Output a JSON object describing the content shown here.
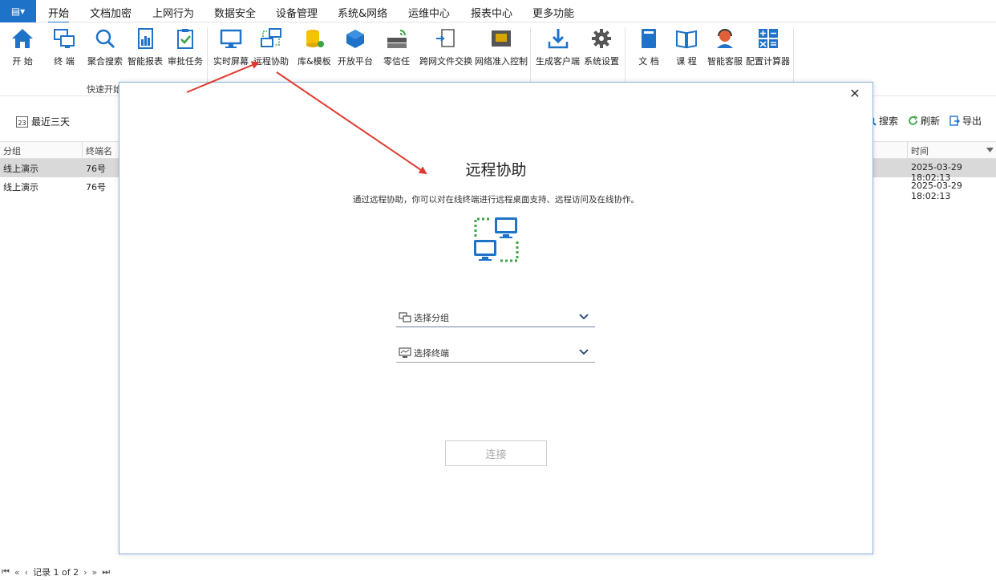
{
  "app_button": "▤▾",
  "menu": [
    "开始",
    "文档加密",
    "上网行为",
    "数据安全",
    "设备管理",
    "系统&网络",
    "运维中心",
    "报表中心",
    "更多功能"
  ],
  "ribbon": {
    "group_label": "快速开始",
    "items": [
      {
        "label": "开 始",
        "icon": "home-icon"
      },
      {
        "label": "终 端",
        "icon": "terminals-icon"
      },
      {
        "label": "聚合搜索",
        "icon": "search-icon"
      },
      {
        "label": "智能报表",
        "icon": "report-icon"
      },
      {
        "label": "审批任务",
        "icon": "approval-icon"
      },
      {
        "label": "实时屏幕",
        "icon": "monitor-icon"
      },
      {
        "label": "远程协助",
        "icon": "remote-icon"
      },
      {
        "label": "库&模板",
        "icon": "database-icon"
      },
      {
        "label": "开放平台",
        "icon": "cube-icon"
      },
      {
        "label": "零信任",
        "icon": "zero-trust-icon"
      },
      {
        "label": "跨网文件交换",
        "icon": "file-exchange-icon"
      },
      {
        "label": "网络准入控制",
        "icon": "access-control-icon"
      },
      {
        "label": "生成客户端",
        "icon": "download-icon"
      },
      {
        "label": "系统设置",
        "icon": "gear-icon"
      },
      {
        "label": "文 档",
        "icon": "book-icon"
      },
      {
        "label": "课 程",
        "icon": "course-icon"
      },
      {
        "label": "智能客服",
        "icon": "support-icon"
      },
      {
        "label": "配置计算器",
        "icon": "calculator-icon"
      }
    ]
  },
  "toolbar": {
    "date_filter": "最近三天",
    "calendar_day": "23",
    "search": "搜索",
    "refresh": "刷新",
    "export": "导出"
  },
  "table": {
    "columns": [
      "分组",
      "终端名",
      "时间"
    ],
    "rows": [
      {
        "group": "线上演示",
        "terminal": "76号",
        "time": "2025-03-29 18:02:13"
      },
      {
        "group": "线上演示",
        "terminal": "76号",
        "time": "2025-03-29 18:02:13"
      }
    ]
  },
  "pager": {
    "text": "记录 1 of 2"
  },
  "dialog": {
    "title": "远程协助",
    "description": "通过远程协助，你可以对在线终端进行远程桌面支持、远程访问及在线协作。",
    "select_group": "选择分组",
    "select_terminal": "选择终端",
    "connect": "连接",
    "close": "✕"
  },
  "colors": {
    "accent": "#1e73c9",
    "annotation_arrow": "#e03a2f",
    "icon_green": "#3aa544"
  }
}
